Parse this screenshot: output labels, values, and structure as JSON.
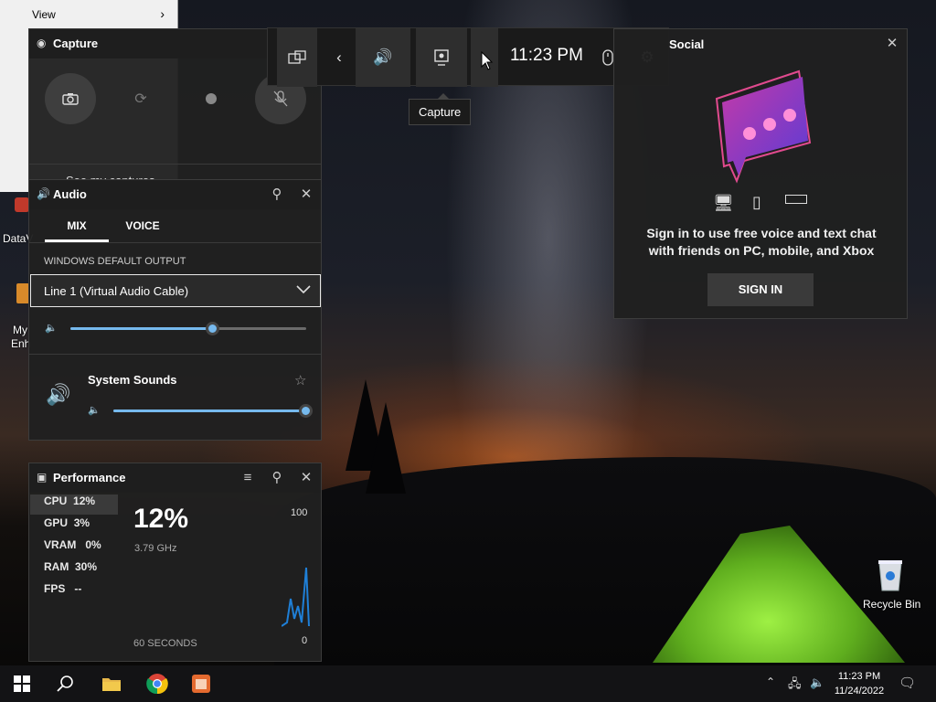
{
  "legacy_window": {
    "menu_label": "View"
  },
  "desktop": {
    "icon_left_1": "DataV",
    "icon_left_2": "My",
    "icon_left_3": "Enh",
    "recycle_bin": "Recycle Bin"
  },
  "capture": {
    "title": "Capture",
    "see_captures": "See my captures"
  },
  "topbar": {
    "time": "11:23 PM",
    "tooltip": "Capture"
  },
  "audio": {
    "title": "Audio",
    "tabs": [
      "MIX",
      "VOICE"
    ],
    "section_label": "WINDOWS DEFAULT OUTPUT",
    "device": "Line 1 (Virtual Audio Cable)",
    "master_volume": 0.6,
    "app_name": "System Sounds",
    "app_volume": 1.0
  },
  "performance": {
    "title": "Performance",
    "stats": [
      {
        "name": "CPU",
        "value": "12%"
      },
      {
        "name": "GPU",
        "value": "3%"
      },
      {
        "name": "VRAM",
        "value": "0%"
      },
      {
        "name": "RAM",
        "value": "30%"
      },
      {
        "name": "FPS",
        "value": "--"
      }
    ],
    "big_value": "12%",
    "sub_value": "3.79 GHz",
    "scale_max": "100",
    "scale_min": "0",
    "window_label": "60 SECONDS",
    "graph_color": "#1f7fd6"
  },
  "social": {
    "title": "Social",
    "message": "Sign in to use free voice and text chat with friends on PC, mobile, and Xbox",
    "sign_in": "SIGN IN"
  },
  "taskbar": {
    "time": "11:23 PM",
    "date": "11/24/2022"
  },
  "colors": {
    "accent": "#76b9ed",
    "panel_bg": "#202020",
    "header_bg": "#1e1e1e"
  }
}
